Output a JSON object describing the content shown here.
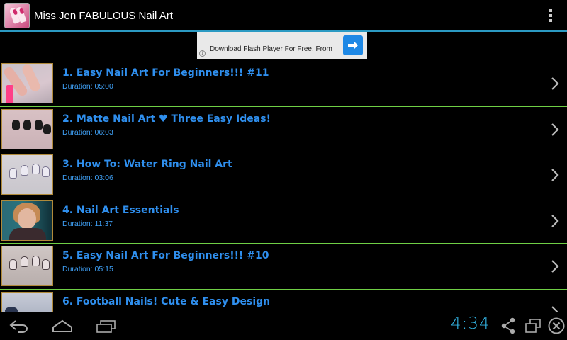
{
  "app": {
    "title": "Miss Jen FABULOUS Nail Art",
    "icon": "nail-polish-app-icon",
    "menu_icon": "overflow-menu-icon"
  },
  "colors": {
    "accent": "#33b5e5",
    "title_blue": "#2f8fee",
    "divider_green": "#6fcf45",
    "background": "#000000"
  },
  "ad": {
    "text": "Download Flash Player For Free, From",
    "info_icon": "info-icon",
    "button_icon": "arrow-right-icon"
  },
  "videos": [
    {
      "title": "1. Easy Nail Art For Beginners!!! #11",
      "duration": "Duration: 05:00"
    },
    {
      "title": "2. Matte Nail Art ♥ Three Easy Ideas!",
      "duration": "Duration: 06:03"
    },
    {
      "title": "3. How To: Water Ring Nail Art",
      "duration": "Duration: 03:06"
    },
    {
      "title": "4. Nail Art Essentials",
      "duration": "Duration: 11:37"
    },
    {
      "title": "5. Easy Nail Art For Beginners!!! #10",
      "duration": "Duration: 05:15"
    },
    {
      "title": "6. Football Nails! Cute & Easy Design",
      "duration": ""
    }
  ],
  "system_bar": {
    "clock": "4:34",
    "back_icon": "back-icon",
    "home_icon": "home-icon",
    "recents_icon": "recent-apps-icon",
    "share_icon": "share-icon",
    "window_icon": "window-icon",
    "close_icon": "close-icon"
  }
}
